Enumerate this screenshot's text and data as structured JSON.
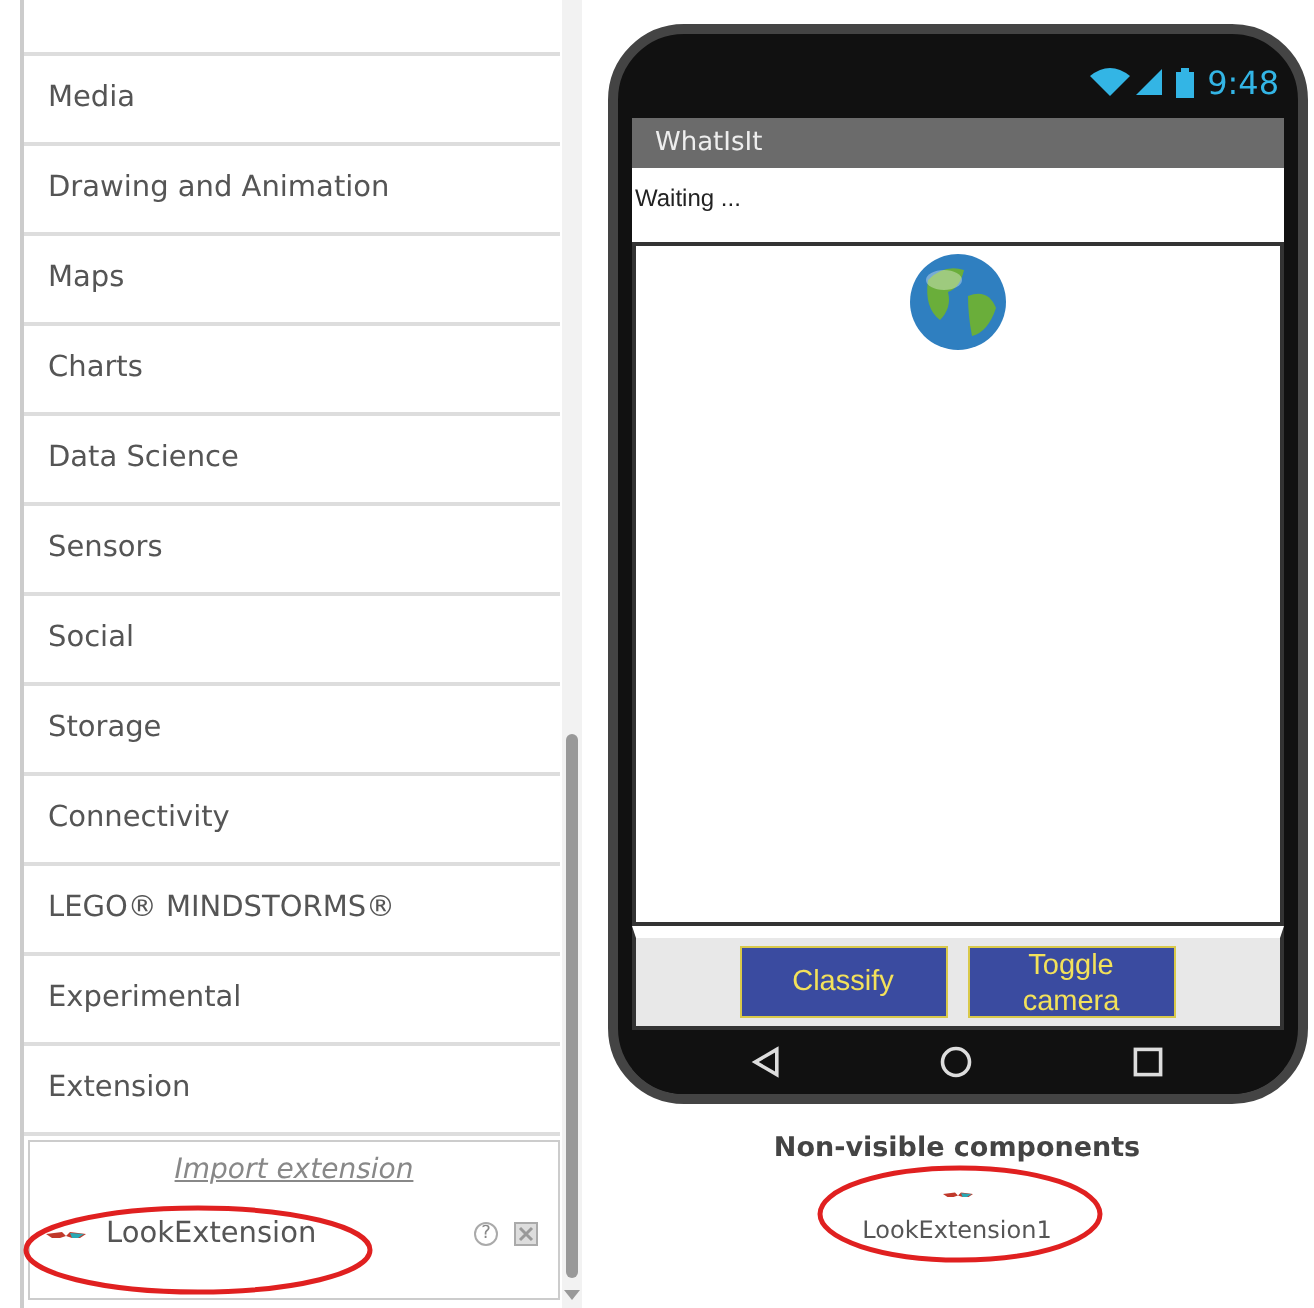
{
  "palette": {
    "categories": [
      {
        "label": "Media"
      },
      {
        "label": "Drawing and Animation"
      },
      {
        "label": "Maps"
      },
      {
        "label": "Charts"
      },
      {
        "label": "Data Science"
      },
      {
        "label": "Sensors"
      },
      {
        "label": "Social"
      },
      {
        "label": "Storage"
      },
      {
        "label": "Connectivity"
      },
      {
        "label": "LEGO® MINDSTORMS®"
      },
      {
        "label": "Experimental"
      },
      {
        "label": "Extension"
      }
    ],
    "import_link": "Import extension",
    "extensions": [
      {
        "label": "LookExtension",
        "help": "?"
      }
    ]
  },
  "phone": {
    "time": "9:48",
    "app_title": "WhatIsIt",
    "status_label": "Waiting ...",
    "buttons": [
      {
        "label": "Classify"
      },
      {
        "label": "Toggle camera"
      }
    ]
  },
  "non_visible": {
    "title": "Non-visible components",
    "components": [
      {
        "label": "LookExtension1"
      }
    ]
  }
}
